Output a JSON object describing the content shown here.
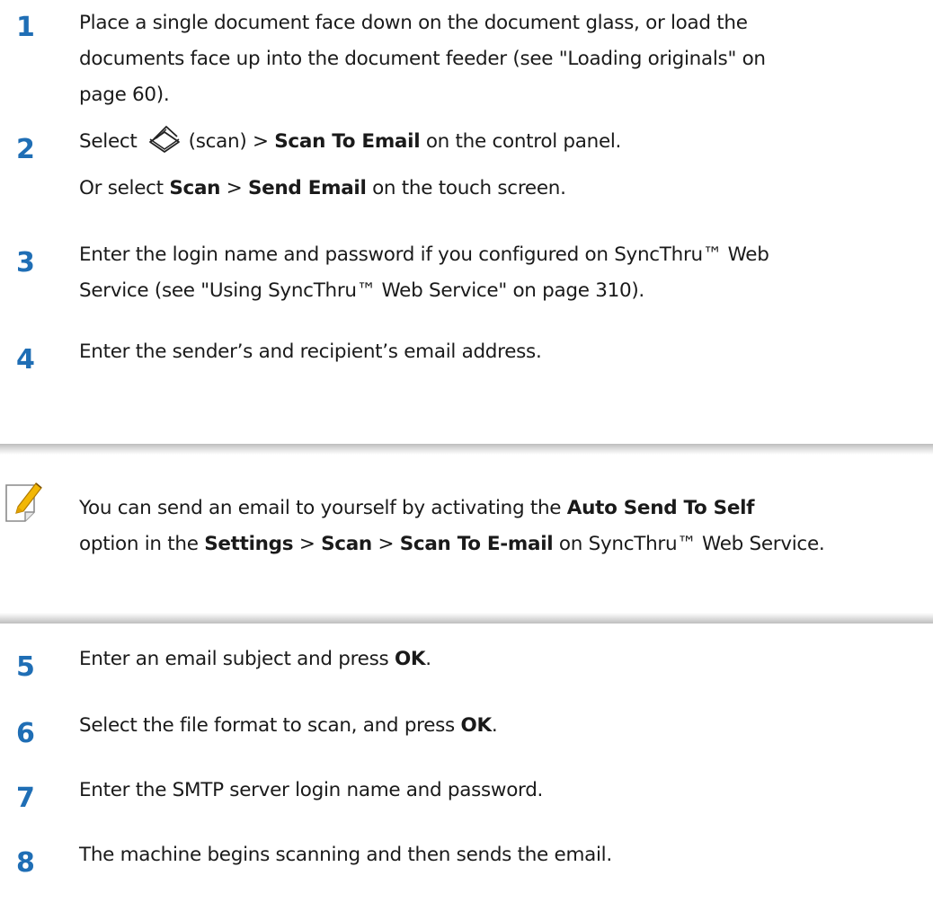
{
  "accent_color": "#1f6eb5",
  "steps": [
    {
      "num": "1",
      "lines": [
        "Place a single document face down on the document glass, or load the",
        "documents face up into the document feeder (see \"Loading originals\" on",
        "page 60)."
      ]
    },
    {
      "num": "2",
      "pre": "Select",
      "icon": "scan-glass-icon",
      "mid": "(scan) >",
      "bold1": "Scan To Email",
      "post": " on the control panel.",
      "sub_pre": "Or select ",
      "sub_bold1": "Scan",
      "sub_sep": " > ",
      "sub_bold2": "Send Email",
      "sub_post": " on the touch screen."
    },
    {
      "num": "3",
      "lines": [
        "Enter the login name and password if you configured on SyncThru™ Web",
        "Service (see \"Using SyncThru™ Web Service\" on page 310)."
      ]
    },
    {
      "num": "4",
      "lines": [
        "Enter the sender’s and recipient’s email address."
      ]
    },
    {
      "num": "5",
      "pre": "Enter an email subject and press ",
      "bold": "OK",
      "post": "."
    },
    {
      "num": "6",
      "pre": "Select the file format to scan, and press ",
      "bold": "OK",
      "post": "."
    },
    {
      "num": "7",
      "lines": [
        "Enter the SMTP server login name and password."
      ]
    },
    {
      "num": "8",
      "lines": [
        "The machine begins scanning and then sends the email."
      ]
    }
  ],
  "note": {
    "icon": "note-pencil-icon",
    "l1_pre": "You can send an email to yourself by activating the ",
    "l1_bold": "Auto Send To Self",
    "l2_pre": "option in the ",
    "l2_b1": "Settings",
    "sep": " > ",
    "l2_b2": "Scan",
    "l2_b3": "Scan To E-mail",
    "l2_post": " on SyncThru™ Web Service."
  }
}
